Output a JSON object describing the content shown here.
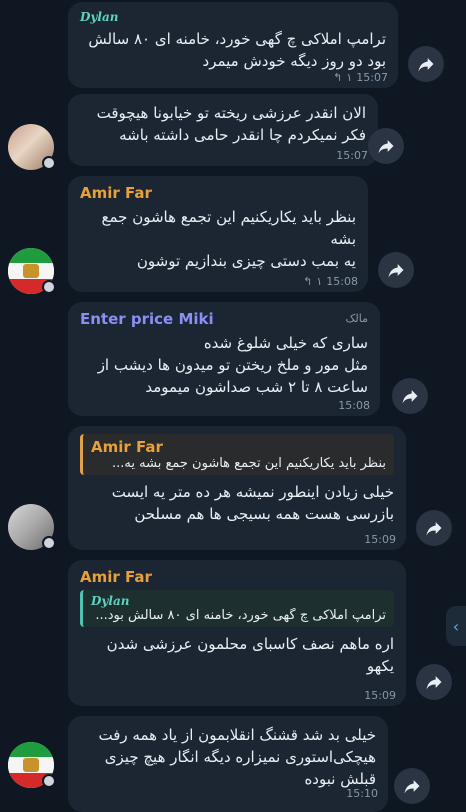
{
  "messages": [
    {
      "sender": "Dylan",
      "lines": [
        "ترامپ املاکی چ گهی خورد، خامنه ای ۸۰ سالش",
        "بود دو روز دیگه خودش میمرد"
      ],
      "replies": "۱",
      "time": "15:07"
    },
    {
      "sender": "",
      "lines": [
        "الان انقدر عرزشی ریخته تو خیابونا هیچوقت",
        "فکر نمیکردم چا انقدر حامی داشته باشه"
      ],
      "time": "15:07"
    },
    {
      "sender": "Amir Far",
      "lines": [
        "بنظر باید یکاریکنیم این تجمع هاشون جمع",
        "بشه",
        "یه بمب دستی چیزی بندازیم توشون"
      ],
      "replies": "۱",
      "time": "15:08"
    },
    {
      "sender": "Enter price Miki",
      "admin_label": "مالک",
      "lines": [
        "ساری که خیلی شلوغ شده",
        "مثل مور و ملخ ریختن تو میدون ها دیشب از",
        "ساعت ۸ تا ۲ شب صداشون میمومد"
      ],
      "time": "15:08"
    },
    {
      "sender": "Amir Far",
      "quote_text": "بنظر باید یکاریکنیم این تجمع هاشون جمع بشه یه...",
      "lines": [
        "خیلی زیادن اینطور نمیشه هر ده متر یه ایست",
        "بازرسی هست همه بسیجی ها هم مسلحن"
      ],
      "time": "15:09"
    },
    {
      "sender": "Amir Far",
      "quote_sender": "Dylan",
      "quote_text": "ترامپ املاکی چ گهی خورد، خامنه ای ۸۰ سالش بود...",
      "lines": [
        "اره ماهم نصف کاسبای محلمون عرزشی شدن",
        "یکهو"
      ],
      "time": "15:09"
    },
    {
      "sender": "",
      "lines": [
        "خیلی بد شد قشنگ انقلابمون از یاد همه رفت",
        "هیچکی‌استوری نمیزاره دیگه انگار هیچ چیزی",
        "قبلش نبوده"
      ],
      "time": "15:10"
    }
  ],
  "colors": {
    "dylan": "#5fd3c0",
    "amir": "#e8a13a",
    "miki": "#8b8ff5",
    "bubble": "#1c2633",
    "time": "#8a97a6"
  },
  "icons": {
    "forward": "forward-arrow-icon",
    "reply": "reply-arrow-icon",
    "chevron": "chevron-left-icon"
  }
}
